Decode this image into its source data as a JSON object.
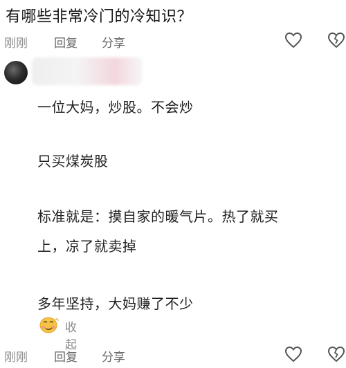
{
  "question": {
    "title": "有哪些非常冷门的冷知识？"
  },
  "top_actions": {
    "time": "刚刚",
    "reply": "回复",
    "share": "分享"
  },
  "comment": {
    "lines": [
      "一位大妈，炒股。不会炒",
      "只买煤炭股",
      "标准就是：摸自家的暖气片。热了就买",
      "上，凉了就卖掉",
      "多年坚持，大妈赚了不少"
    ],
    "collapse_label": "收起"
  },
  "bottom_actions": {
    "time": "刚刚",
    "reply": "回复",
    "share": "分享"
  },
  "colors": {
    "text": "#1e1e1e",
    "meta_gray": "#8e8e8e",
    "icon_gray": "#555555"
  },
  "icons": [
    "heart-outline-icon",
    "heart-broken-icon",
    "smirk-emoji-icon",
    "avatar"
  ]
}
